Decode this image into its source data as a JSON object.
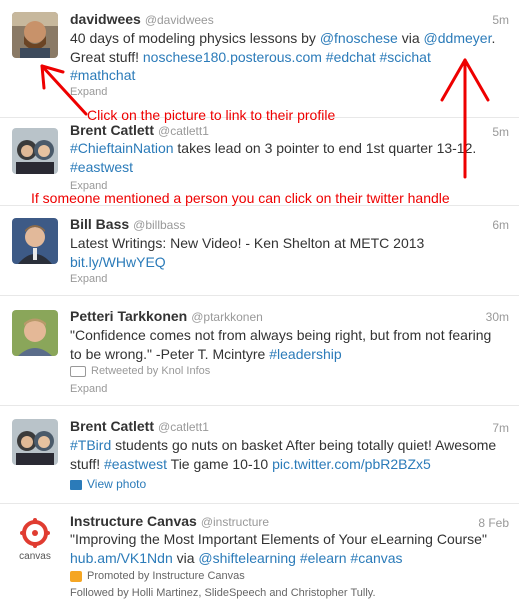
{
  "tweets": [
    {
      "name": "davidwees",
      "handle": "@davidwees",
      "time": "5m",
      "lines": [
        [
          {
            "t": "40 days of modeling physics lessons by "
          },
          {
            "t": "@fnoschese",
            "l": 1
          },
          {
            "t": " via "
          },
          {
            "t": "@ddmeyer",
            "l": 1
          },
          {
            "t": "."
          }
        ],
        [
          {
            "t": "Great stuff! "
          },
          {
            "t": "noschese180.posterous.com",
            "l": 1
          },
          {
            "t": " "
          },
          {
            "t": "#edchat",
            "l": 1
          },
          {
            "t": " "
          },
          {
            "t": "#scichat",
            "l": 1
          }
        ],
        [
          {
            "t": "#mathchat",
            "l": 1
          }
        ]
      ],
      "expand": "Expand"
    },
    {
      "name": "Brent Catlett",
      "handle": "@catlett1",
      "time": "5m",
      "lines": [
        [
          {
            "t": "#ChieftainNation",
            "l": 1
          },
          {
            "t": " takes lead on 3 pointer to end 1st quarter 13-12."
          }
        ],
        [
          {
            "t": "#eastwest",
            "l": 1
          }
        ]
      ],
      "expand": "Expand"
    },
    {
      "name": "Bill Bass",
      "handle": "@billbass",
      "time": "6m",
      "lines": [
        [
          {
            "t": "Latest Writings: New Video! - Ken Shelton at METC 2013"
          }
        ],
        [
          {
            "t": "bit.ly/WHwYEQ",
            "l": 1
          }
        ]
      ],
      "expand": "Expand"
    },
    {
      "name": "Petteri Tarkkonen",
      "handle": "@ptarkkonen",
      "time": "30m",
      "lines": [
        [
          {
            "t": "\"Confidence comes not from always being right, but from not fearing"
          }
        ],
        [
          {
            "t": "to be wrong.\" -Peter T. Mcintyre "
          },
          {
            "t": "#leadership",
            "l": 1
          }
        ]
      ],
      "retweeted": "Retweeted by Knol Infos",
      "expand": "Expand"
    },
    {
      "name": "Brent Catlett",
      "handle": "@catlett1",
      "time": "7m",
      "lines": [
        [
          {
            "t": "#TBird",
            "l": 1
          },
          {
            "t": " students go nuts on basket After being totally quiet! Awesome"
          }
        ],
        [
          {
            "t": "stuff! "
          },
          {
            "t": "#eastwest",
            "l": 1
          },
          {
            "t": " Tie game 10-10 "
          },
          {
            "t": "pic.twitter.com/pbR2BZx5",
            "l": 1
          }
        ]
      ],
      "view_photo": "View photo"
    },
    {
      "name": "Instructure Canvas",
      "handle": "@instructure",
      "time": "8 Feb",
      "lines": [
        [
          {
            "t": "\"Improving the Most Important Elements of Your eLearning Course\""
          }
        ],
        [
          {
            "t": "hub.am/VK1Ndn",
            "l": 1
          },
          {
            "t": " via "
          },
          {
            "t": "@shiftelearning",
            "l": 1
          },
          {
            "t": " "
          },
          {
            "t": "#elearn",
            "l": 1
          },
          {
            "t": " "
          },
          {
            "t": "#canvas",
            "l": 1
          }
        ]
      ],
      "promoted": "Promoted by Instructure Canvas",
      "followed": "Followed by Holli Martinez, SlideSpeech and Christopher Tully.",
      "logo_text": "canvas"
    }
  ],
  "annotations": {
    "profile_tip": "Click on the picture to link to their profile",
    "handle_tip": "If someone mentioned a person you can click on their twitter handle"
  },
  "colors": {
    "link": "#2b7bb9",
    "annotation": "#ee0000",
    "muted": "#999999"
  }
}
